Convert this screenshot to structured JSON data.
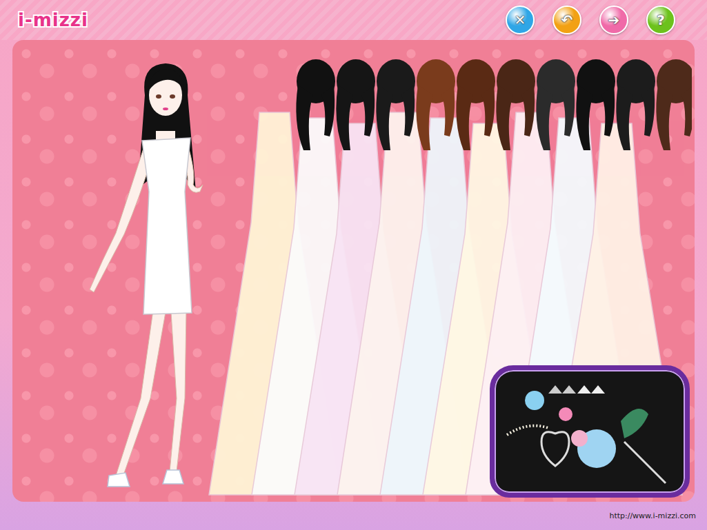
{
  "logo": {
    "text": "i-mizzi"
  },
  "toolbar": [
    {
      "glyph": "✕",
      "color": "#2fa6e6"
    },
    {
      "glyph": "↶",
      "color": "#f2a114"
    },
    {
      "glyph": "➔",
      "color": "#f06aa8"
    },
    {
      "glyph": "?",
      "color": "#6cc21c"
    }
  ],
  "hairstyles": [
    {
      "color": "#111111"
    },
    {
      "color": "#151515"
    },
    {
      "color": "#1a1a1a"
    },
    {
      "color": "#7a3b1c"
    },
    {
      "color": "#5a2a14"
    },
    {
      "color": "#4a2616"
    },
    {
      "color": "#2b2b2b"
    },
    {
      "color": "#111111"
    },
    {
      "color": "#1c1c1c"
    },
    {
      "color": "#4e2a1a"
    }
  ],
  "dresses": [
    {
      "color": "#fff4d6"
    },
    {
      "color": "#fbfbfb"
    },
    {
      "color": "#f8e4f4"
    },
    {
      "color": "#fdf3ee"
    },
    {
      "color": "#eef6fb"
    },
    {
      "color": "#fff8e4"
    },
    {
      "color": "#fdf0f4"
    },
    {
      "color": "#f4fafd"
    },
    {
      "color": "#fff1e6"
    }
  ],
  "footer": {
    "url": "http://www.i-mizzi.com"
  }
}
